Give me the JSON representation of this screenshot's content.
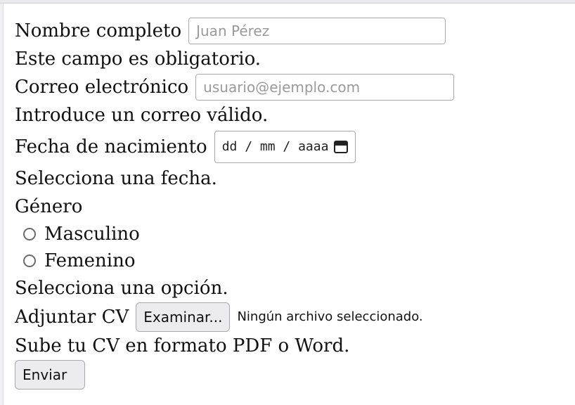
{
  "form": {
    "name": {
      "label": "Nombre completo",
      "placeholder": "Juan Pérez",
      "value": "",
      "message": "Este campo es obligatorio."
    },
    "email": {
      "label": "Correo electrónico",
      "placeholder": "usuario@ejemplo.com",
      "value": "",
      "message": "Introduce un correo válido."
    },
    "birthdate": {
      "label": "Fecha de nacimiento",
      "placeholder": "dd / mm / aaaa",
      "message": "Selecciona una fecha."
    },
    "gender": {
      "label": "Género",
      "options": [
        {
          "label": "Masculino",
          "selected": false
        },
        {
          "label": "Femenino",
          "selected": false
        }
      ],
      "message": "Selecciona una opción."
    },
    "cv": {
      "label": "Adjuntar CV",
      "button_label": "Examinar...",
      "status": "Ningún archivo seleccionado.",
      "message": "Sube tu CV en formato PDF o Word."
    },
    "submit_label": "Enviar"
  }
}
